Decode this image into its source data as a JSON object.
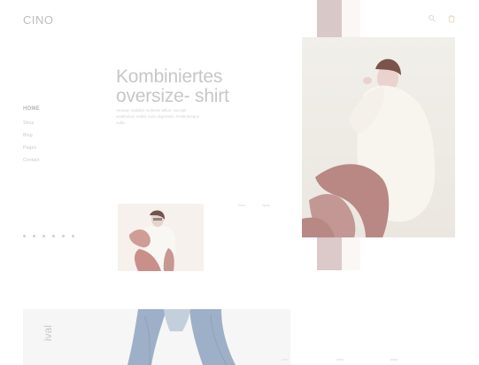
{
  "brand": {
    "logo": "CINO"
  },
  "header": {
    "icons": [
      "search-icon",
      "bag-icon"
    ]
  },
  "nav": {
    "items": [
      {
        "label": "HOME",
        "active": true
      },
      {
        "label": "Shop"
      },
      {
        "label": "Blog"
      },
      {
        "label": "Pages"
      },
      {
        "label": "Contact"
      }
    ]
  },
  "hero": {
    "title_line1": "Kombiniertes",
    "title_line2": "oversize- shirt",
    "text": "Aenean sodales molestie tellus, suscipit vestibulum mattis nunc dignissim. Pellentesque nulla."
  },
  "gallery": {
    "mini_label_1": "Prev",
    "mini_label_2": "Next"
  },
  "bottom": {
    "vertical_text": "ival"
  },
  "colors": {
    "accent": "#d8c8c8",
    "light_bg": "#f6f6f6",
    "text_muted": "#c7c7c7"
  }
}
